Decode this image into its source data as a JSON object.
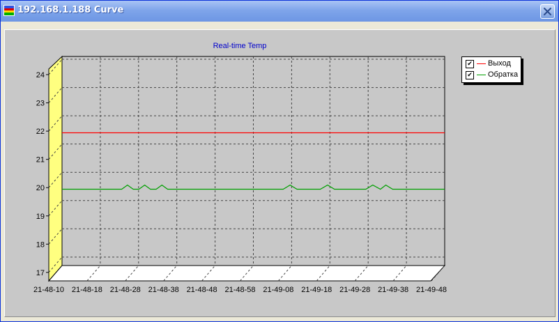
{
  "window": {
    "title": "192.168.1.188 Curve",
    "app_icon": "rainbow-app-icon",
    "close_icon": "close-x-icon",
    "titlebar_color": "#7fa5ea"
  },
  "chart_data": {
    "type": "line",
    "title": "Real-time Temp",
    "title_color": "#0000cc",
    "xlabel": "",
    "ylabel": "",
    "ylim": [
      16.7,
      24.1
    ],
    "y_ticks": [
      "17",
      "18",
      "19",
      "20",
      "21",
      "22",
      "23",
      "24"
    ],
    "x_ticks": [
      "21-48-10",
      "21-48-18",
      "21-48-28",
      "21-48-38",
      "21-48-48",
      "21-48-58",
      "21-49-08",
      "21-49-18",
      "21-49-28",
      "21-49-38",
      "21-49-48"
    ],
    "grid": true,
    "three_d": true,
    "legend_position": "top-right",
    "series": [
      {
        "name": "Выход",
        "color": "#ff0000",
        "checked": true,
        "x": [
          0,
          100
        ],
        "y": [
          21.4,
          21.4
        ]
      },
      {
        "name": "Обратка",
        "color": "#00a000",
        "checked": true,
        "x": [
          0,
          15.6,
          17.1,
          18.6,
          20.1,
          21.6,
          23.1,
          24.6,
          26.1,
          27.6,
          29.1,
          30.6,
          57.8,
          59.6,
          61.4,
          67.5,
          69.4,
          71.2,
          79.4,
          81.2,
          83.2,
          84.6,
          86.4,
          88.1,
          100,
          101.5
        ],
        "y": [
          19.4,
          19.4,
          19.55,
          19.4,
          19.4,
          19.55,
          19.4,
          19.4,
          19.55,
          19.4,
          19.4,
          19.4,
          19.4,
          19.55,
          19.4,
          19.4,
          19.55,
          19.4,
          19.4,
          19.55,
          19.4,
          19.55,
          19.4,
          19.4,
          19.4,
          19.55
        ]
      }
    ]
  }
}
